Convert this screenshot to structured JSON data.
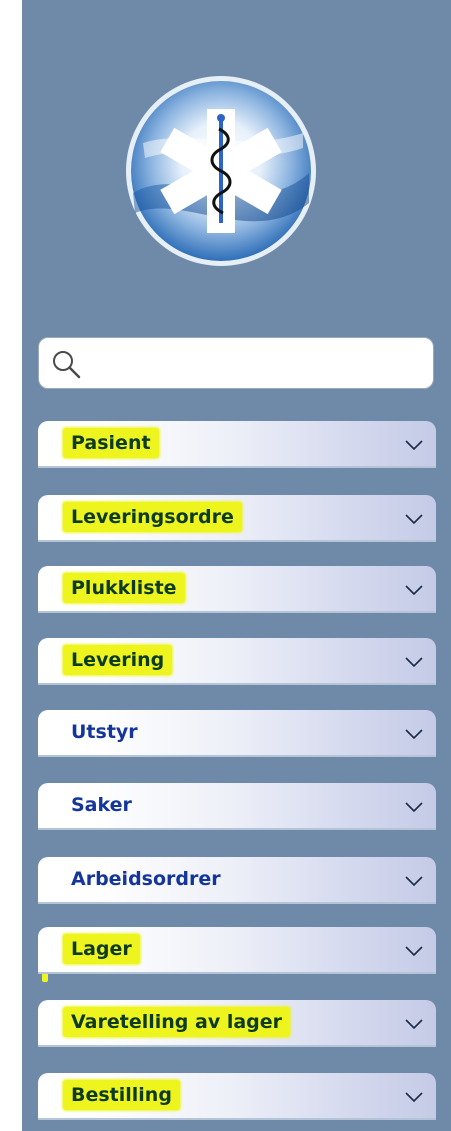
{
  "search": {
    "placeholder": "",
    "value": ""
  },
  "menu": {
    "items": [
      {
        "label": "Pasient",
        "highlighted": true
      },
      {
        "label": "Leveringsordre",
        "highlighted": true
      },
      {
        "label": "Plukkliste",
        "highlighted": true
      },
      {
        "label": "Levering",
        "highlighted": true
      },
      {
        "label": "Utstyr",
        "highlighted": false
      },
      {
        "label": "Saker",
        "highlighted": false
      },
      {
        "label": "Arbeidsordrer",
        "highlighted": false
      },
      {
        "label": "Lager",
        "highlighted": true
      },
      {
        "label": "Varetelling av lager",
        "highlighted": true
      },
      {
        "label": "Bestilling",
        "highlighted": true
      }
    ],
    "expand_icon": "chevron-down-icon"
  },
  "logo": {
    "icon": "star-of-life-icon"
  },
  "colors": {
    "sidebar_background": "#6f8aa9",
    "label_text": "#14369a",
    "highlight": "#eef51e"
  }
}
